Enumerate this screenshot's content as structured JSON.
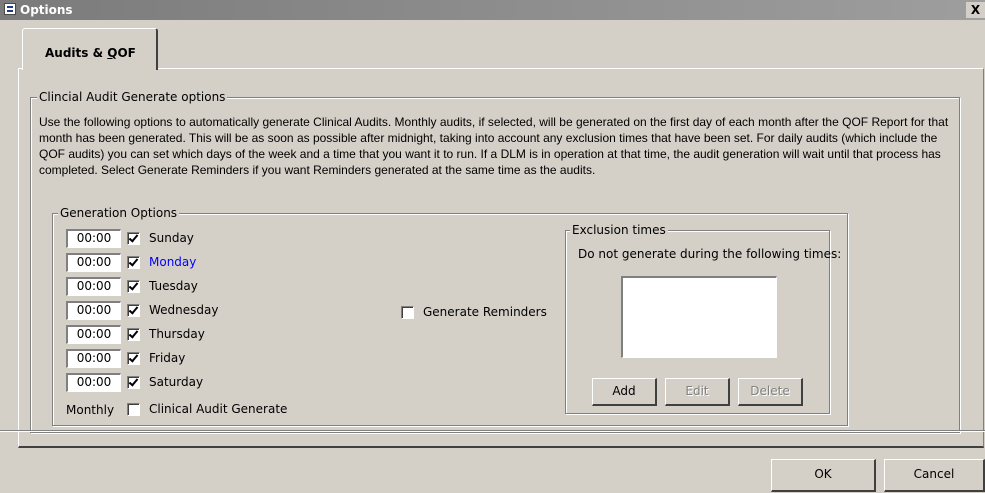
{
  "window": {
    "title": "Options",
    "close_glyph": "X"
  },
  "tabs": [
    {
      "label": "Audits & QOF",
      "active": true
    }
  ],
  "clinical_audit": {
    "legend": "Clincial Audit Generate options",
    "description": "Use the following options to automatically generate Clinical Audits. Monthly audits, if selected, will be generated on the first day of each month after the QOF Report for that month has been generated.  This will be as soon as possible after midnight, taking into account any exclusion times that have been set.  For daily audits (which include the QOF audits) you can set which days of the week and a time that you want it to run.  If a DLM is in operation at that time, the audit generation will wait until that process has completed.  Select Generate Reminders if you want Reminders generated at the same time as the audits."
  },
  "generation_options": {
    "legend": "Generation Options",
    "days": [
      {
        "time": "00:00",
        "checked": true,
        "label": "Sunday"
      },
      {
        "time": "00:00",
        "checked": true,
        "label": "Monday",
        "highlight_color": "#0000ff"
      },
      {
        "time": "00:00",
        "checked": true,
        "label": "Tuesday"
      },
      {
        "time": "00:00",
        "checked": true,
        "label": "Wednesday"
      },
      {
        "time": "00:00",
        "checked": true,
        "label": "Thursday"
      },
      {
        "time": "00:00",
        "checked": true,
        "label": "Friday"
      },
      {
        "time": "00:00",
        "checked": true,
        "label": "Saturday"
      }
    ],
    "monthly_label": "Monthly",
    "monthly_option": {
      "checked": false,
      "label": "Clinical Audit Generate"
    },
    "generate_reminders": {
      "checked": false,
      "label": "Generate Reminders"
    }
  },
  "exclusion_times": {
    "legend": "Exclusion times",
    "caption": "Do not generate during the following times:",
    "items": [],
    "buttons": {
      "add": "Add",
      "edit": "Edit",
      "delete": "Delete"
    }
  },
  "footer": {
    "ok": "OK",
    "cancel": "Cancel"
  },
  "colors": {
    "dialog_bg": "#d4d0c8",
    "title_bar": "#7b7b7b",
    "link_blue": "#0000ff"
  }
}
